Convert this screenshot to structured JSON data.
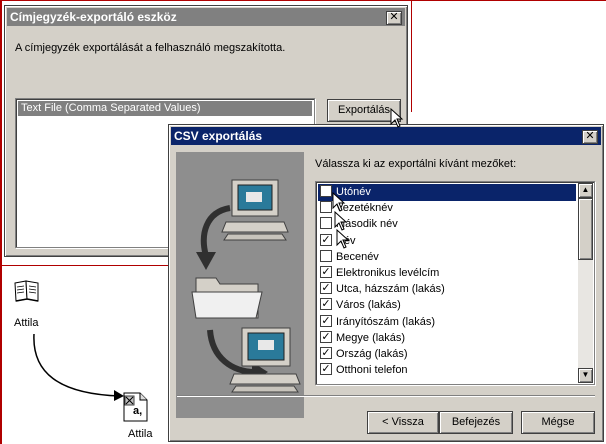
{
  "back_window": {
    "title": "Címjegyzék-exportáló eszköz",
    "message": "A címjegyzék exportálását a felhasználó megszakította.",
    "list_item": "Text File (Comma Separated Values)",
    "export_button": "Exportálás"
  },
  "desktop": {
    "book_label": "Attila",
    "file_label": "Attila",
    "file_badge": "a,"
  },
  "csv_dialog": {
    "title": "CSV exportálás",
    "instruction": "Válassza ki az exportálni kívánt mezőket:",
    "fields": [
      {
        "label": "Utónév",
        "checked": false
      },
      {
        "label": "Vezetéknév",
        "checked": false
      },
      {
        "label": "Második név",
        "checked": false
      },
      {
        "label": "Név",
        "checked": true
      },
      {
        "label": "Becenév",
        "checked": false
      },
      {
        "label": "Elektronikus levélcím",
        "checked": true
      },
      {
        "label": "Utca, házszám (lakás)",
        "checked": true
      },
      {
        "label": "Város (lakás)",
        "checked": true
      },
      {
        "label": "Irányítószám (lakás)",
        "checked": true
      },
      {
        "label": "Megye (lakás)",
        "checked": true
      },
      {
        "label": "Ország (lakás)",
        "checked": true
      },
      {
        "label": "Otthoni telefon",
        "checked": true
      }
    ],
    "back_button": "< Vissza",
    "finish_button": "Befejezés",
    "cancel_button": "Mégse"
  },
  "colors": {
    "accent_border": "#b00000",
    "active_title": "#0a246a",
    "inactive_title": "#808080",
    "face": "#d4d0c8",
    "selection": "#0a246a"
  }
}
